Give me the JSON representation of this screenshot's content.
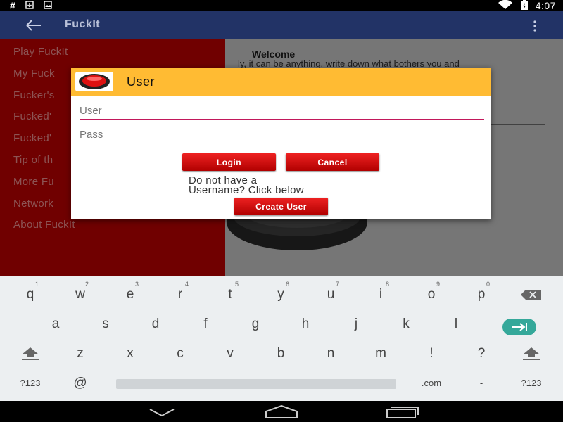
{
  "status_bar": {
    "left_icons": [
      "hash-icon",
      "download-icon",
      "image-icon"
    ],
    "right_icons": [
      "wifi-icon",
      "battery-charging-icon"
    ],
    "time": "4:07"
  },
  "app_bar": {
    "title": "FuckIt"
  },
  "content": {
    "welcome_title": "Welcome",
    "welcome_text": "ly, it can be anything, write down what bothers you and"
  },
  "drawer": {
    "items": [
      "Play FuckIt",
      "My Fuck",
      "Fucker's",
      "Fucked'",
      "Fucked'",
      "Tip of th",
      "More Fu",
      "Network",
      "About FuckIt"
    ]
  },
  "dialog": {
    "title": "User",
    "username_placeholder": "User",
    "password_placeholder": "Pass",
    "login_label": "Login",
    "cancel_label": "Cancel",
    "hint_line1": "Do not have a",
    "hint_line2": "Username? Click below",
    "create_label": "Create User"
  },
  "keyboard": {
    "row1": [
      {
        "key": "q",
        "num": "1"
      },
      {
        "key": "w",
        "num": "2"
      },
      {
        "key": "e",
        "num": "3"
      },
      {
        "key": "r",
        "num": "4"
      },
      {
        "key": "t",
        "num": "5"
      },
      {
        "key": "y",
        "num": "6"
      },
      {
        "key": "u",
        "num": "7"
      },
      {
        "key": "i",
        "num": "8"
      },
      {
        "key": "o",
        "num": "9"
      },
      {
        "key": "p",
        "num": "0"
      }
    ],
    "row2": [
      "a",
      "s",
      "d",
      "f",
      "g",
      "h",
      "j",
      "k",
      "l"
    ],
    "row3": [
      "z",
      "x",
      "c",
      "v",
      "b",
      "n",
      "m",
      "!",
      "?"
    ],
    "row4": {
      "sym": "?123",
      "at": "@",
      "dotcom": ".com",
      "dash": "-",
      "sym2": "?123"
    }
  },
  "colors": {
    "app_bar": "#223366",
    "drawer": "#cc0000",
    "dialog_header": "#ffbb33",
    "button": "#dd1111",
    "input_focus": "#c2185b",
    "enter_key": "#35a89a"
  }
}
